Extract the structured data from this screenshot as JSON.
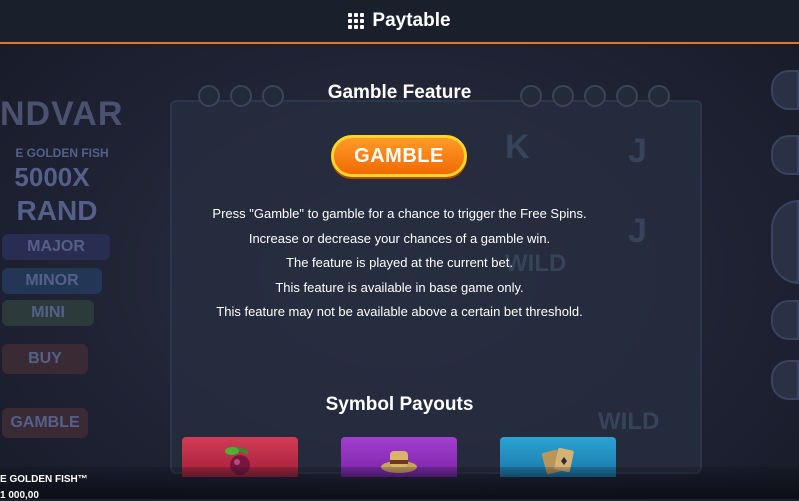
{
  "header": {
    "title": "Paytable",
    "icon": "grid-icon"
  },
  "gamble_section": {
    "title": "Gamble Feature",
    "button_label": "GAMBLE",
    "lines": [
      "Press \"Gamble\" to gamble for a chance to trigger the Free Spins.",
      "Increase or decrease your chances of a gamble win.",
      "The feature is played at the current bet.",
      "This feature is available in base game only.",
      "This feature may not be available above a certain bet threshold."
    ],
    "button_colors": {
      "fill": "#f57f12",
      "border": "#ffd52a"
    }
  },
  "symbol_section": {
    "title": "Symbol Payouts",
    "cards": [
      {
        "icon": "cherry-icon",
        "color": "#c7304c"
      },
      {
        "icon": "hat-icon",
        "color": "#9435c2"
      },
      {
        "icon": "cards-icon",
        "color": "#2496c6"
      }
    ]
  },
  "background": {
    "left_labels": [
      "NDVAR",
      "E GOLDEN FISH",
      "5000X",
      "RAND",
      "MAJOR",
      "MINOR",
      "MINI",
      "BUY",
      "GAMBLE"
    ],
    "reel_symbols": [
      "K",
      "J",
      "J",
      "WILD",
      "WILD"
    ]
  },
  "bottom": {
    "game_name": "E GOLDEN FISH™",
    "amount": "1 000,00"
  },
  "colors": {
    "accent": "#e0782b",
    "header_bg": "#1a1f2c"
  }
}
